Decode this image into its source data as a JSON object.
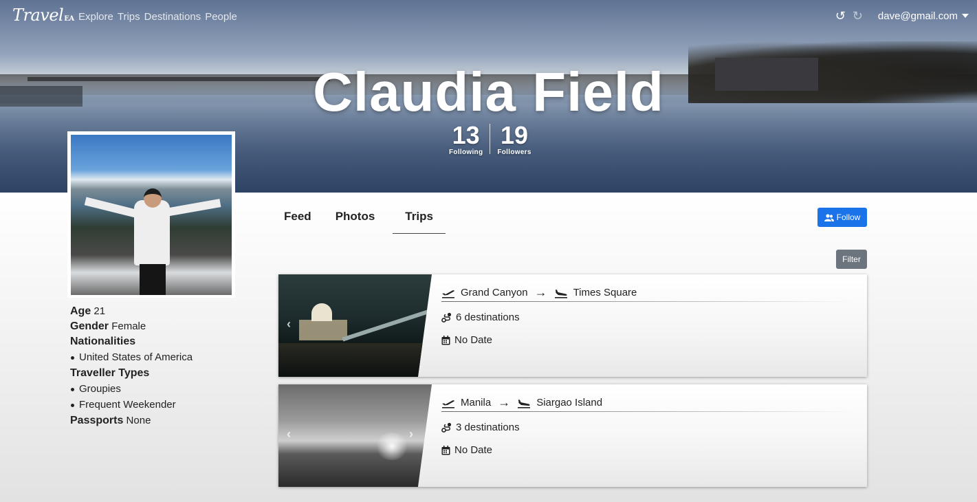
{
  "nav": {
    "logo": "Travel",
    "logo_suffix": "EA",
    "links": [
      "Explore",
      "Trips",
      "Destinations",
      "People"
    ],
    "user_email": "dave@gmail.com",
    "undo_icon": "undo-icon",
    "redo_icon": "redo-icon"
  },
  "profile": {
    "name": "Claudia Field",
    "following_count": "13",
    "following_label": "Following",
    "followers_count": "19",
    "followers_label": "Followers"
  },
  "details": {
    "age_label": "Age",
    "age": "21",
    "gender_label": "Gender",
    "gender": "Female",
    "nationalities_label": "Nationalities",
    "nationalities": [
      "United States of America"
    ],
    "traveller_types_label": "Traveller Types",
    "traveller_types": [
      "Groupies",
      "Frequent Weekender"
    ],
    "passports_label": "Passports",
    "passports": "None"
  },
  "tabs": [
    {
      "label": "Feed",
      "active": false
    },
    {
      "label": "Photos",
      "active": false
    },
    {
      "label": "Trips",
      "active": true
    }
  ],
  "actions": {
    "follow_label": "Follow",
    "filter_label": "Filter"
  },
  "trips": [
    {
      "from": "Grand Canyon",
      "to": "Times Square",
      "destinations": "6 destinations",
      "date": "No Date"
    },
    {
      "from": "Manila",
      "to": "Siargao Island",
      "destinations": "3 destinations",
      "date": "No Date"
    }
  ],
  "colors": {
    "primary": "#1a73e8",
    "secondary": "#6c757d"
  }
}
